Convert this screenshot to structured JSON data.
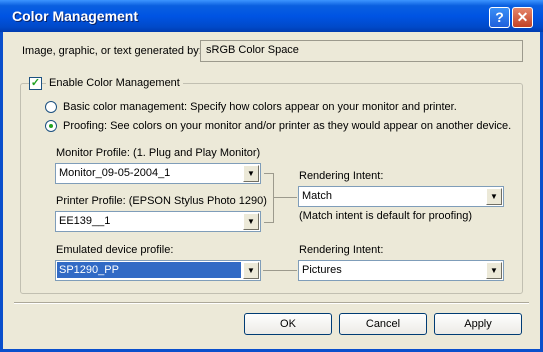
{
  "window": {
    "title": "Color Management"
  },
  "source": {
    "label": "Image, graphic, or text generated by:",
    "value": "sRGB Color Space"
  },
  "color_management": {
    "enable_label": "Enable Color Management",
    "enabled": true,
    "basic_label": "Basic color management: Specify how colors appear on your monitor and printer.",
    "proofing_label": "Proofing: See colors on your monitor and/or printer as they would appear on another device.",
    "selected_mode": "proofing"
  },
  "monitor": {
    "label": "Monitor Profile: (1. Plug and Play Monitor)",
    "value": "Monitor_09-05-2004_1"
  },
  "printer": {
    "label": "Printer Profile: (EPSON Stylus Photo 1290)",
    "value": "EE139__1"
  },
  "rendering_intent_1": {
    "label": "Rendering Intent:",
    "value": "Match",
    "note": "(Match intent is default for proofing)"
  },
  "emulated": {
    "label": "Emulated device profile:",
    "value": "SP1290_PP"
  },
  "rendering_intent_2": {
    "label": "Rendering Intent:",
    "value": "Pictures"
  },
  "buttons": {
    "ok": "OK",
    "cancel": "Cancel",
    "apply": "Apply"
  },
  "icons": {
    "help": "?",
    "close": "✕",
    "checkmark": "✓",
    "dropdown": "▼"
  }
}
